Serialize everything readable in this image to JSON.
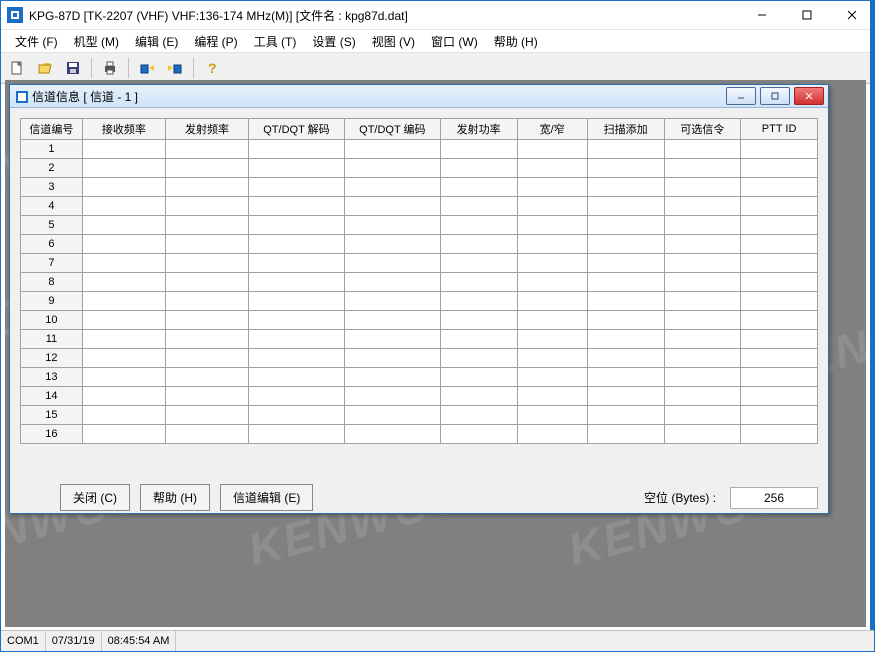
{
  "window": {
    "title": "KPG-87D [TK-2207 (VHF) VHF:136-174 MHz(M)] [文件名 : kpg87d.dat]"
  },
  "menu": {
    "items": [
      "文件 (F)",
      "机型 (M)",
      "编辑 (E)",
      "编程 (P)",
      "工具 (T)",
      "设置 (S)",
      "视图 (V)",
      "窗口 (W)",
      "帮助 (H)"
    ]
  },
  "toolbar": {
    "icons": [
      "new",
      "open",
      "save",
      "print",
      "radio-read",
      "radio-write",
      "help"
    ]
  },
  "child": {
    "title": "信道信息 [ 信道 - 1 ]",
    "columns": [
      "信道编号",
      "接收频率",
      "发射频率",
      "QT/DQT 解码",
      "QT/DQT 编码",
      "发射功率",
      "宽/窄",
      "扫描添加",
      "可选信令",
      "PTT ID"
    ],
    "rows": [
      "1",
      "2",
      "3",
      "4",
      "5",
      "6",
      "7",
      "8",
      "9",
      "10",
      "11",
      "12",
      "13",
      "14",
      "15",
      "16"
    ],
    "buttons": {
      "close": "关闭 (C)",
      "help": "帮助 (H)",
      "edit": "信道编辑 (E)"
    },
    "bytes_label": "空位 (Bytes) :",
    "bytes_value": "256"
  },
  "watermark": "KENWOOD",
  "status": {
    "port": "COM1",
    "date": "07/31/19",
    "time": "08:45:54 AM"
  }
}
